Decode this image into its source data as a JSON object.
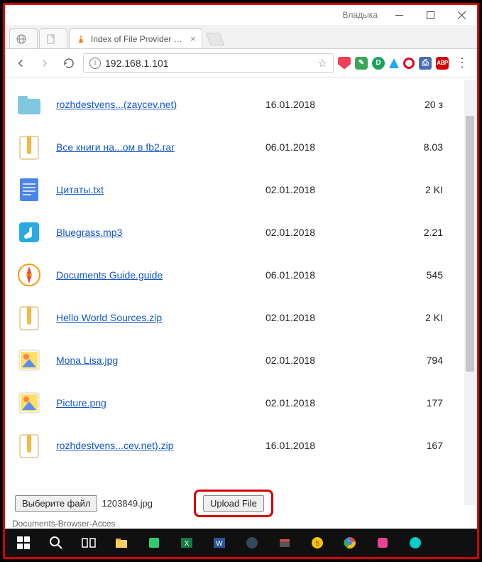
{
  "titlebar": {
    "user_label": "Владыка"
  },
  "tabs": {
    "active": {
      "title": "Index of File Provider St…"
    }
  },
  "addressbar": {
    "url": "192.168.1.101"
  },
  "files": [
    {
      "name": "rozhdestvens...(zaycev.net)",
      "date": "16.01.2018",
      "size": "20 з",
      "icon": "folder"
    },
    {
      "name": "Все книги на...ом в fb2.rar",
      "date": "06.01.2018",
      "size": "8.03",
      "icon": "archive"
    },
    {
      "name": "Цитаты.txt",
      "date": "02.01.2018",
      "size": "2 KI",
      "icon": "doc"
    },
    {
      "name": "Bluegrass.mp3",
      "date": "02.01.2018",
      "size": "2.21",
      "icon": "audio"
    },
    {
      "name": "Documents Guide.guide",
      "date": "06.01.2018",
      "size": "545",
      "icon": "guide"
    },
    {
      "name": "Hello World Sources.zip",
      "date": "02.01.2018",
      "size": "2 KI",
      "icon": "archive"
    },
    {
      "name": "Mona Lisa.jpg",
      "date": "02.01.2018",
      "size": "794",
      "icon": "image"
    },
    {
      "name": "Picture.png",
      "date": "02.01.2018",
      "size": "177",
      "icon": "image"
    },
    {
      "name": "rozhdestvens...cev.net).zip",
      "date": "16.01.2018",
      "size": "167",
      "icon": "archive"
    }
  ],
  "upload": {
    "choose_label": "Выберите файл",
    "chosen_file": "1203849.jpg",
    "upload_label": "Upload File"
  },
  "overflow_text": "Documents-Browser-Acces"
}
